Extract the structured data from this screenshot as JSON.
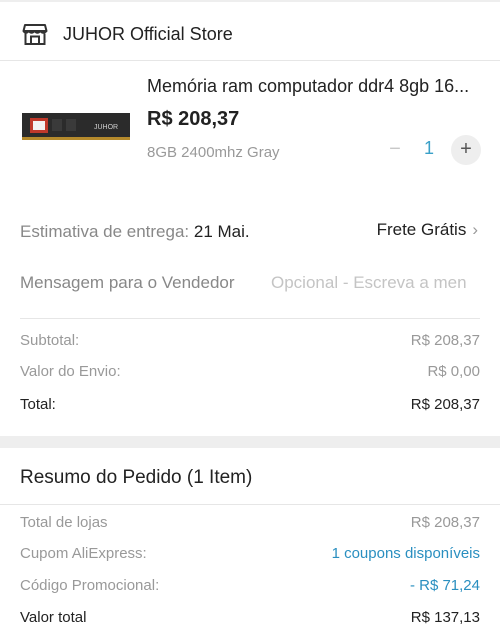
{
  "store": {
    "name": "JUHOR Official Store",
    "icon": "store-icon"
  },
  "product": {
    "title": "Memória ram computador ddr4 8gb 16...",
    "price": "R$ 208,37",
    "variant": "8GB 2400mhz Gray",
    "quantity": "1",
    "minus_label": "−",
    "plus_label": "+",
    "module_label": "JUHOR"
  },
  "delivery": {
    "label": "Estimativa de entrega: ",
    "date": "21 Mai.",
    "shipping": "Frete Grátis"
  },
  "message": {
    "label": "Mensagem para o Vendedor",
    "placeholder": "Opcional - Escreva a men"
  },
  "cost_summary": {
    "subtotal_label": "Subtotal:",
    "subtotal_value": "R$ 208,37",
    "shipping_label": "Valor do Envio:",
    "shipping_value": "R$ 0,00",
    "total_label": "Total:",
    "total_value": "R$ 208,37"
  },
  "order_summary": {
    "title": "Resumo do Pedido (1 Item)",
    "stores_total_label": "Total de lojas",
    "stores_total_value": "R$ 208,37",
    "coupon_label": "Cupom AliExpress:",
    "coupon_value": "1 coupons disponíveis",
    "promo_label": "Código Promocional:",
    "promo_value": "- R$ 71,24",
    "grand_total_label": "Valor total",
    "grand_total_value": "R$ 137,13"
  },
  "colors": {
    "accent_blue": "#2a8fc0",
    "quantity_blue": "#3aa0c8",
    "muted_text": "#999999",
    "background": "#eeeeee"
  }
}
